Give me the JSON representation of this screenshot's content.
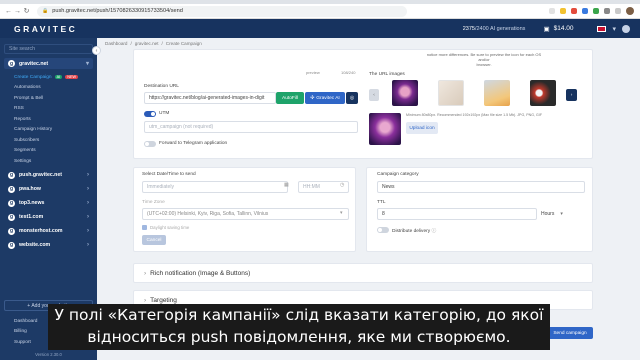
{
  "browser": {
    "url": "push.gravitec.net/push/157082633091573350​4/send",
    "nav": [
      "←",
      "→",
      "↻"
    ]
  },
  "header": {
    "logo": "GRAVITEC",
    "ai_used": "2375",
    "ai_total": "/2400 AI generations",
    "balance": "$14.00"
  },
  "sidebar": {
    "search_placeholder": "Site search",
    "current_site": "gravitec.net",
    "items": [
      {
        "label": "Create Campaign",
        "active": true
      },
      {
        "label": "Automations"
      },
      {
        "label": "Prompt & Bell"
      },
      {
        "label": "RSS"
      },
      {
        "label": "Reports"
      },
      {
        "label": "Campaign History"
      },
      {
        "label": "Subscribers"
      },
      {
        "label": "Segments"
      },
      {
        "label": "Settings"
      }
    ],
    "badge_new": "AI",
    "badge_hot": "NEW",
    "sites": [
      "push.gravitec.net",
      "pwa.how",
      "top3.news",
      "test1.com",
      "monsterhost.com",
      "website.com"
    ],
    "add_site": "+ Add your website",
    "bottom_items": [
      "Dashboard",
      "Billing",
      "Support"
    ],
    "version": "Version 2.30.0"
  },
  "breadcrumb": [
    "Dashboard",
    "/",
    "gravitec.net",
    "/",
    "Create Campaign"
  ],
  "top_panel": {
    "note_line1": "notice more differences. Be sure to preview the icon for each OS and/or",
    "note_line2": "browser.",
    "char_counter": "108/240",
    "preview_hint": "preview"
  },
  "destination": {
    "label": "Destination URL",
    "value": "https://gravitec.net/blog/ai-generated-images-in-digit",
    "autofill_label": "AutoFill",
    "ai_label": "Gravitec AI",
    "utm_label": "UTM",
    "utm_placeholder": "utm_campaign (not required)",
    "telegram_label": "Forward to Telegram application"
  },
  "images": {
    "label": "The URL images",
    "hint": "Minimum 80x80px. Recommended 192x192px (Max file size 1.5 Mb). JPG, PNG, GIF",
    "upload_label": "Upload icon"
  },
  "schedule": {
    "label": "Select Date/Time to send",
    "date_placeholder": "Immediately",
    "time_placeholder": "HH:MM",
    "tz_label": "Time Zone",
    "tz_value": "(UTC+02:00) Helsinki, Kyiv, Riga, Sofia, Tallinn, Vilnius",
    "dst_label": "Daylight saving time",
    "cancel_label": "Cancel"
  },
  "category": {
    "label": "Campaign category",
    "value": "News",
    "ttl_label": "TTL",
    "ttl_value": "8",
    "ttl_unit": "Hours",
    "distribute_label": "Distribute delivery"
  },
  "sections": {
    "rich": "Rich notification (Image & Buttons)",
    "targeting": "Targeting"
  },
  "send_label": "Send campaign",
  "caption": "У полі «Категорія кампанії» слід вказати категорію, до якої відноситься push повідомлення, яке ми створюємо."
}
